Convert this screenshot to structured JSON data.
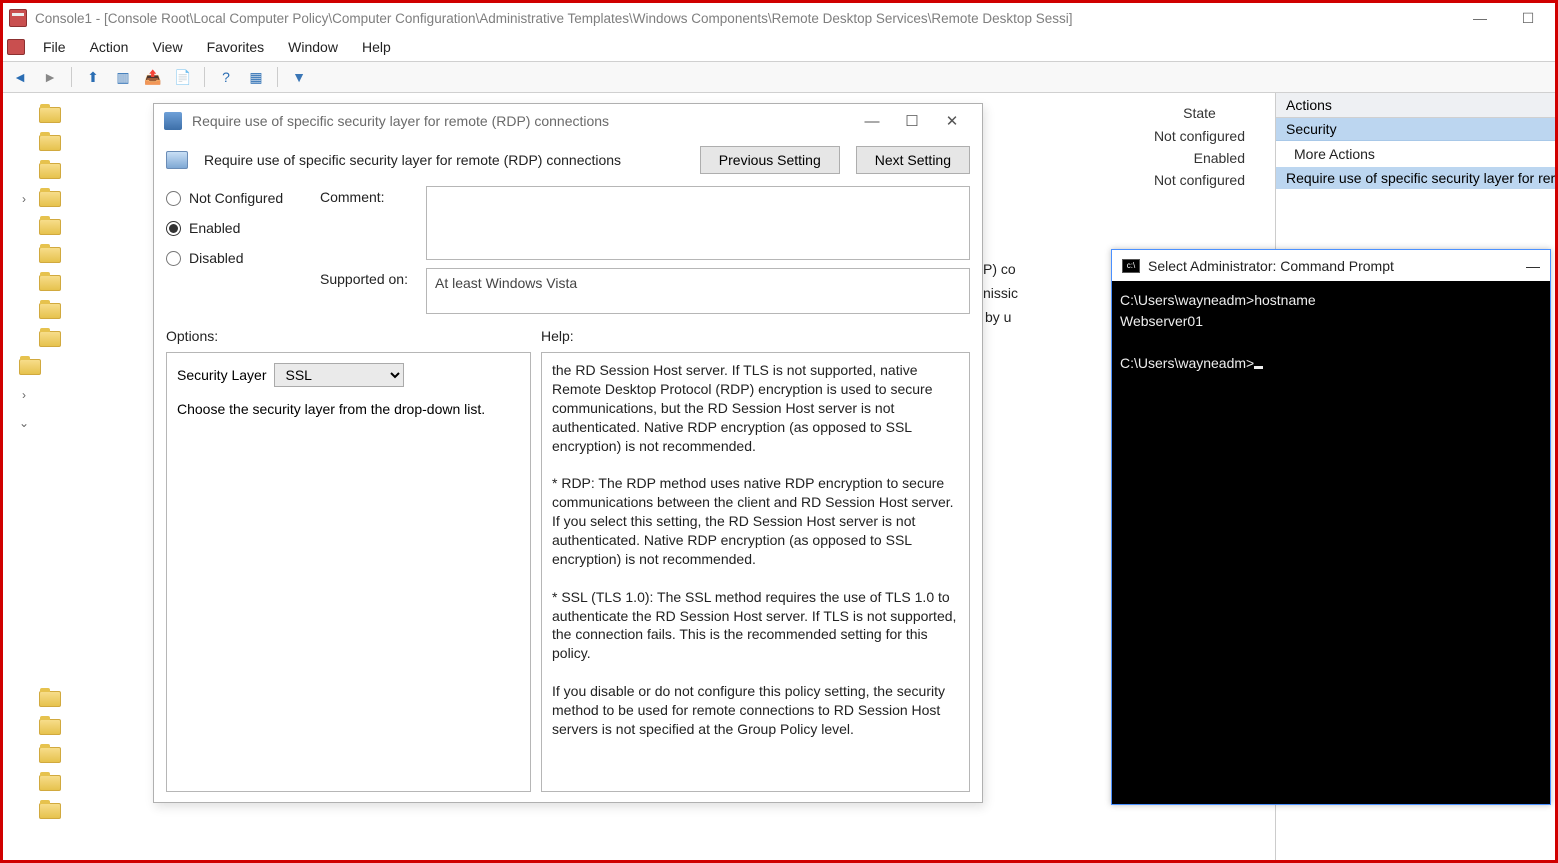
{
  "window": {
    "title": "Console1 - [Console Root\\Local Computer Policy\\Computer Configuration\\Administrative Templates\\Windows Components\\Remote Desktop Services\\Remote Desktop Sessi]"
  },
  "menubar": {
    "items": [
      "File",
      "Action",
      "View",
      "Favorites",
      "Window",
      "Help"
    ]
  },
  "actions": {
    "header": "Actions",
    "section": "Security",
    "more1": "More Actions",
    "current": "Require use of specific security layer for rer"
  },
  "state": {
    "header": "State",
    "rows": [
      "Not configured",
      "Enabled",
      "Not configured"
    ]
  },
  "backing": {
    "frag1": "P) co",
    "frag2": "nissic",
    "frag3": "by u"
  },
  "dialog": {
    "title": "Require use of specific security layer for remote (RDP) connections",
    "setting_name": "Require use of specific security layer for remote (RDP) connections",
    "prev_btn": "Previous Setting",
    "next_btn": "Next Setting",
    "radio": {
      "nc": "Not Configured",
      "en": "Enabled",
      "dis": "Disabled"
    },
    "comment_label": "Comment:",
    "supported_label": "Supported on:",
    "supported_text": "At least Windows Vista",
    "options_label": "Options:",
    "help_label": "Help:",
    "security_layer_label": "Security Layer",
    "security_layer_value": "SSL",
    "security_layer_hint": "Choose the security layer from the drop-down list.",
    "help_text": "the RD Session Host server. If TLS is not supported, native Remote Desktop Protocol (RDP) encryption is used to secure communications, but the RD Session Host server is not authenticated. Native RDP encryption (as opposed to SSL encryption) is not recommended.\n\n* RDP: The RDP method uses native RDP encryption to secure communications between the client and RD Session Host server. If you select this setting, the RD Session Host server is not authenticated. Native RDP encryption (as opposed to SSL encryption) is not recommended.\n\n* SSL (TLS 1.0): The SSL method requires the use of TLS 1.0 to authenticate the RD Session Host server. If TLS is not supported, the connection fails. This is the recommended setting for this policy.\n\nIf you disable or do not configure this policy setting, the security method to be used for remote connections to RD Session Host servers is not specified at the Group Policy level."
  },
  "cmd": {
    "title": "Select Administrator: Command Prompt",
    "line1": "C:\\Users\\wayneadm>hostname",
    "line2": "Webserver01",
    "line3": "C:\\Users\\wayneadm>"
  }
}
